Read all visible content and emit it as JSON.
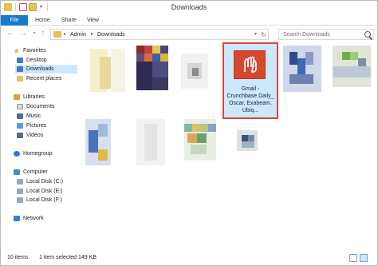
{
  "window": {
    "title": "Downloads"
  },
  "ribbon": {
    "tabs": [
      "File",
      "Home",
      "Share",
      "View"
    ]
  },
  "address_bar": {
    "crumbs": [
      "Admin",
      "Downloads"
    ]
  },
  "search": {
    "placeholder": "Search Downloads"
  },
  "nav_pane": {
    "favorites_label": "Favorites",
    "favorites": [
      "Desktop",
      "Downloads",
      "Recent places"
    ],
    "libraries_label": "Libraries",
    "libraries": [
      "Documents",
      "Music",
      "Pictures",
      "Videos"
    ],
    "homegroup_label": "Homegroup",
    "computer_label": "Computer",
    "drives": [
      "Local Disk (C:)",
      "Local Disk (E:)",
      "Local Disk (F:)"
    ],
    "network_label": "Network"
  },
  "selected_file": {
    "name": "Gmail - Crunchbase Daily_ Oscar, Exabeam, Ubiq...",
    "icon": "pdf-file-icon"
  },
  "status": {
    "items": "10 items",
    "selection": "1 item selected 149 KB"
  },
  "colors": {
    "accent": "#1979ca",
    "selection": "#cce8ff",
    "highlight_border": "#d9463a",
    "pdf_red": "#d7472d"
  }
}
